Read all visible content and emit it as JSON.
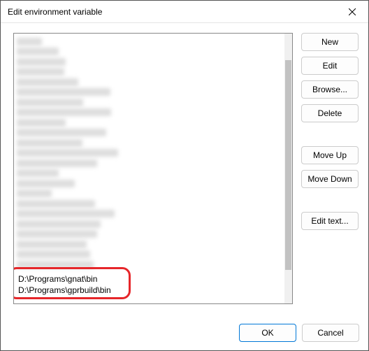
{
  "window": {
    "title": "Edit environment variable"
  },
  "buttons": {
    "new": "New",
    "edit": "Edit",
    "browse": "Browse...",
    "delete": "Delete",
    "move_up": "Move Up",
    "move_down": "Move Down",
    "edit_text": "Edit text...",
    "ok": "OK",
    "cancel": "Cancel"
  },
  "list": {
    "visible_items": [
      "D:\\Programs\\gnat\\bin",
      "D:\\Programs\\gprbuild\\bin"
    ],
    "blurred_count": 23
  }
}
